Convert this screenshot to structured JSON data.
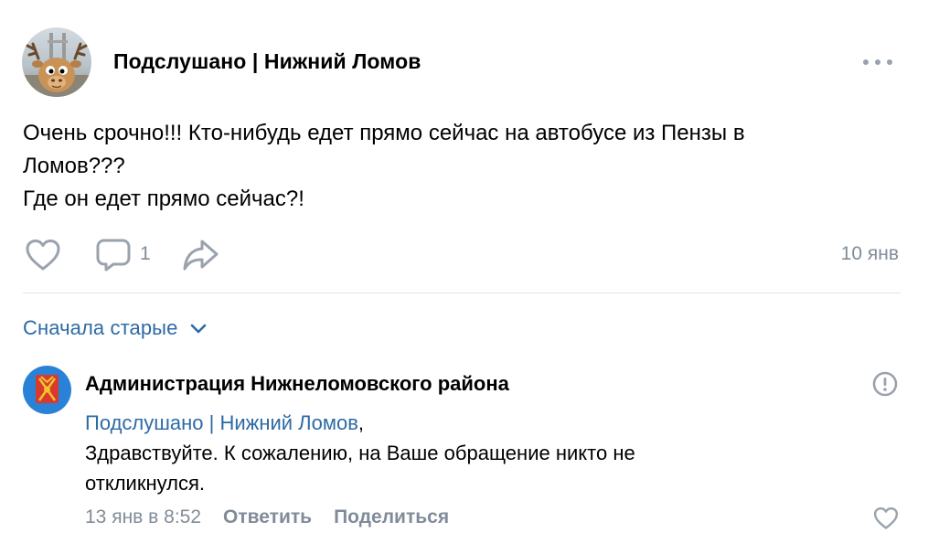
{
  "post": {
    "group_name": "Подслушано | Нижний Ломов",
    "text_lines": [
      "Очень срочно!!! Кто-нибудь едет прямо сейчас на автобусе из Пензы в",
      "Ломов???",
      "Где он едет прямо сейчас?!"
    ],
    "comment_count": "1",
    "date": "10 янв"
  },
  "comments_section": {
    "sort_label": "Сначала старые"
  },
  "comment": {
    "author": "Администрация Нижнеломовского района",
    "reply_to": "Подслушано | Нижний Ломов",
    "reply_suffix": ",",
    "text_lines": [
      "Здравствуйте. К сожалению, на Ваше обращение никто не",
      "откликнулся."
    ],
    "time": "13 янв в 8:52",
    "reply_label": "Ответить",
    "share_label": "Поделиться"
  },
  "icons": {
    "more": "more-dots-icon",
    "like": "heart-icon",
    "comment": "comment-bubble-icon",
    "share": "share-arrow-icon",
    "sort": "chevron-down-icon",
    "report": "report-exclamation-icon"
  },
  "colors": {
    "link": "#2d6aa5",
    "secondary": "#818c99",
    "icon": "#99a2ad",
    "admin_avatar_bg": "#2a81d8"
  }
}
